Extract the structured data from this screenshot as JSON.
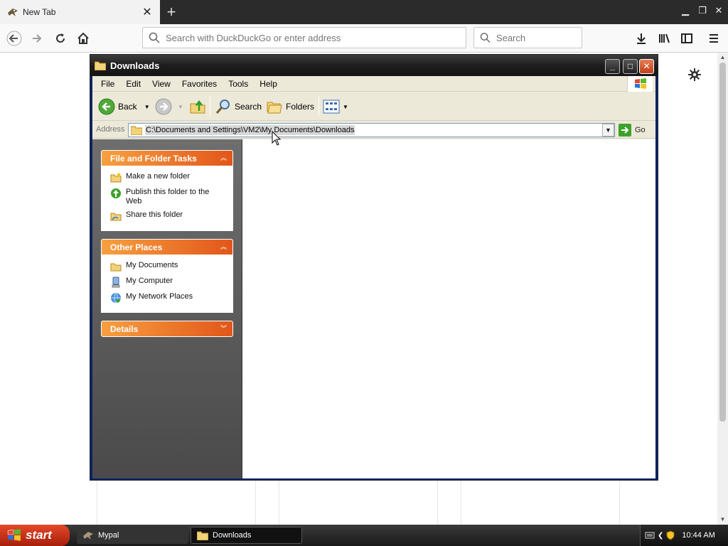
{
  "browser": {
    "tab": {
      "title": "New Tab",
      "close_icon": "close-icon"
    },
    "new_tab_icon": "plus-icon",
    "window_controls": {
      "minimize": "minimize-icon",
      "restore": "restore-icon",
      "close": "close-icon"
    },
    "nav": {
      "back": "back-arrow-icon",
      "forward": "forward-arrow-icon",
      "reload": "reload-icon",
      "home": "home-icon"
    },
    "urlbar": {
      "placeholder": "Search with DuckDuckGo or enter address"
    },
    "searchbar": {
      "placeholder": "Search"
    },
    "toolbar_icons": [
      "download-icon",
      "library-icon",
      "sidebar-icon",
      "menu-icon"
    ]
  },
  "explorer": {
    "title": "Downloads",
    "menu": [
      "File",
      "Edit",
      "View",
      "Favorites",
      "Tools",
      "Help"
    ],
    "toolbar": {
      "back": "Back",
      "search": "Search",
      "folders": "Folders"
    },
    "address": {
      "label": "Address",
      "path": "C:\\Documents and Settings\\VM2\\My Documents\\Downloads",
      "go": "Go"
    },
    "panels": {
      "tasks": {
        "title": "File and Folder Tasks",
        "items": [
          "Make a new folder",
          "Publish this folder to the Web",
          "Share this folder"
        ]
      },
      "places": {
        "title": "Other Places",
        "items": [
          "My Documents",
          "My Computer",
          "My Network Places"
        ]
      },
      "details": {
        "title": "Details"
      }
    }
  },
  "taskbar": {
    "start": "start",
    "tasks": [
      "Mypal",
      "Downloads"
    ],
    "clock": "10:44 AM"
  },
  "colors": {
    "xp_orange_start": "#f7a040",
    "xp_orange_end": "#e2561a",
    "start_red": "#e4482a",
    "titlebar": "#1e1e1e"
  }
}
